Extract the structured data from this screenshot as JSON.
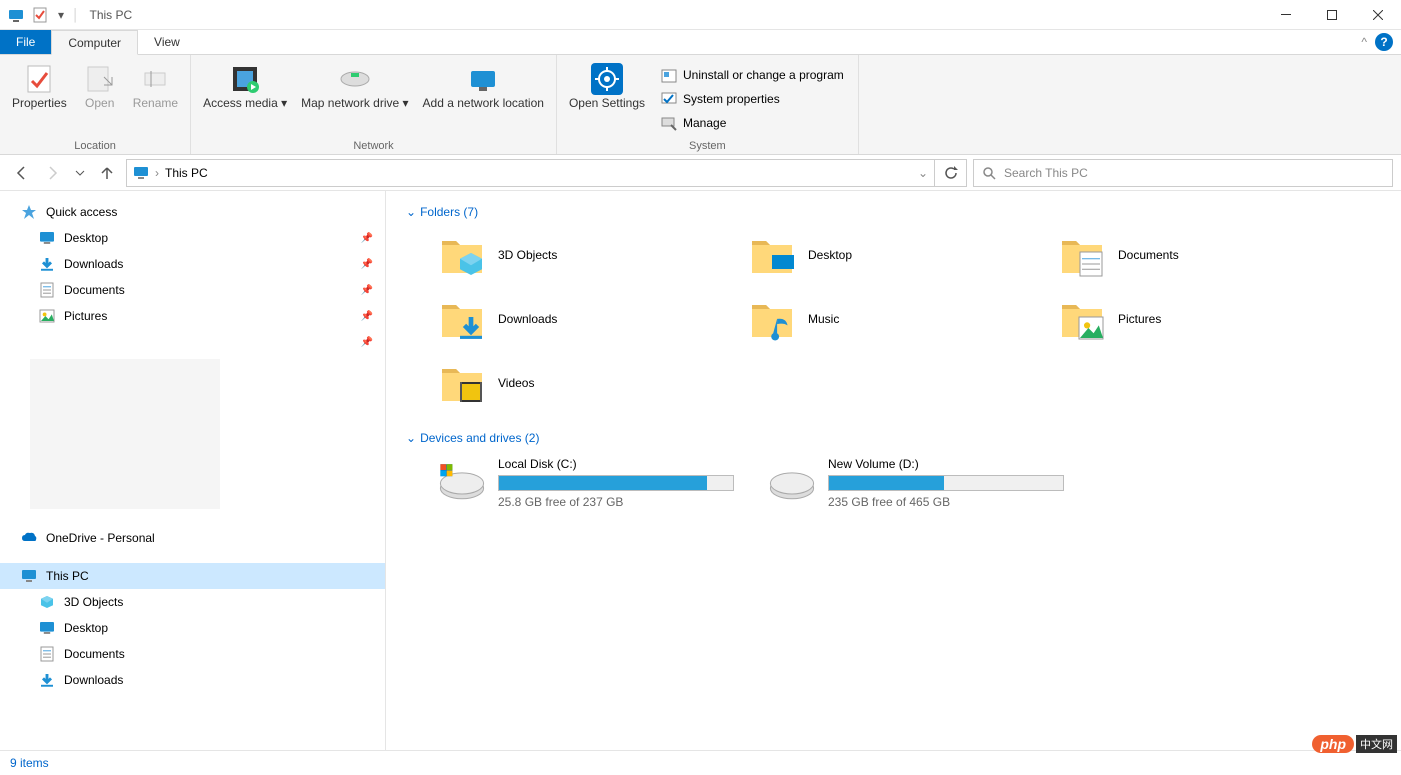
{
  "window": {
    "title": "This PC"
  },
  "ribbon": {
    "tabs": {
      "file": "File",
      "computer": "Computer",
      "view": "View"
    },
    "location": {
      "label": "Location",
      "properties": "Properties",
      "open": "Open",
      "rename": "Rename"
    },
    "network": {
      "label": "Network",
      "access_media": "Access media ▾",
      "map_drive": "Map network drive ▾",
      "add_location": "Add a network location"
    },
    "settings_btn": "Open Settings",
    "system": {
      "label": "System",
      "uninstall": "Uninstall or change a program",
      "properties": "System properties",
      "manage": "Manage"
    }
  },
  "address": {
    "location": "This PC",
    "search_placeholder": "Search This PC"
  },
  "sidebar": {
    "quick_access": "Quick access",
    "pinned": [
      {
        "label": "Desktop",
        "icon": "desktop"
      },
      {
        "label": "Downloads",
        "icon": "downloads"
      },
      {
        "label": "Documents",
        "icon": "documents"
      },
      {
        "label": "Pictures",
        "icon": "pictures"
      }
    ],
    "onedrive": "OneDrive - Personal",
    "this_pc": "This PC",
    "pc_children": [
      {
        "label": "3D Objects",
        "icon": "3d"
      },
      {
        "label": "Desktop",
        "icon": "desktop"
      },
      {
        "label": "Documents",
        "icon": "documents"
      },
      {
        "label": "Downloads",
        "icon": "downloads"
      }
    ]
  },
  "content": {
    "folders_header": "Folders (7)",
    "folders": [
      {
        "label": "3D Objects",
        "icon": "3d"
      },
      {
        "label": "Desktop",
        "icon": "desktop"
      },
      {
        "label": "Documents",
        "icon": "documents"
      },
      {
        "label": "Downloads",
        "icon": "downloads"
      },
      {
        "label": "Music",
        "icon": "music"
      },
      {
        "label": "Pictures",
        "icon": "pictures"
      },
      {
        "label": "Videos",
        "icon": "videos"
      }
    ],
    "drives_header": "Devices and drives (2)",
    "drives": [
      {
        "label": "Local Disk (C:)",
        "free": "25.8 GB free of 237 GB",
        "percent": 89,
        "icon": "cdrive"
      },
      {
        "label": "New Volume (D:)",
        "free": "235 GB free of 465 GB",
        "percent": 49,
        "icon": "drive"
      }
    ]
  },
  "status": {
    "items": "9 items"
  },
  "watermark": {
    "php": "php",
    "cn": "中文网"
  }
}
